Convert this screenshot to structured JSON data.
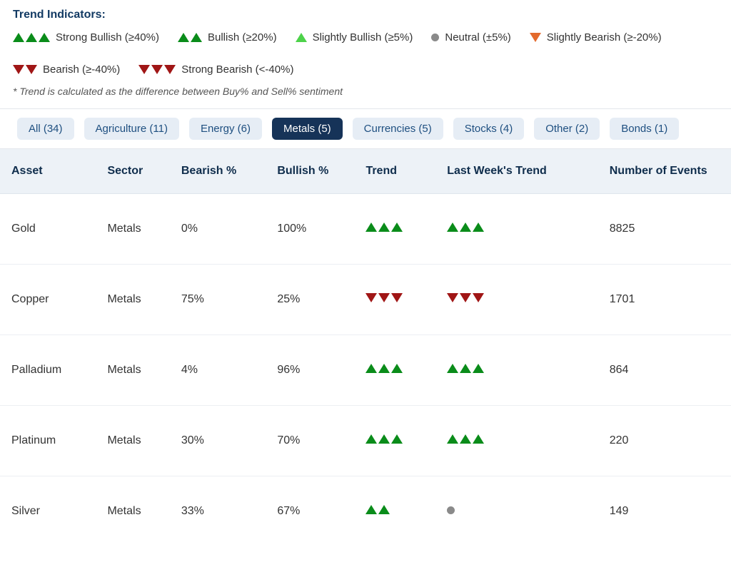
{
  "legend": {
    "title": "Trend Indicators:",
    "items": [
      {
        "icon": "up3-green",
        "label": "Strong Bullish (≥40%)"
      },
      {
        "icon": "up2-green",
        "label": "Bullish (≥20%)"
      },
      {
        "icon": "up1-lgreen",
        "label": "Slightly Bullish (≥5%)"
      },
      {
        "icon": "dot",
        "label": "Neutral (±5%)"
      },
      {
        "icon": "down1-orange",
        "label": "Slightly Bearish (≥-20%)"
      },
      {
        "icon": "down2-red",
        "label": "Bearish (≥-40%)"
      },
      {
        "icon": "down3-red",
        "label": "Strong Bearish (<-40%)"
      }
    ],
    "footnote": "* Trend is calculated as the difference between Buy% and Sell% sentiment"
  },
  "tabs": [
    {
      "label": "All (34)",
      "active": false
    },
    {
      "label": "Agriculture (11)",
      "active": false
    },
    {
      "label": "Energy (6)",
      "active": false
    },
    {
      "label": "Metals (5)",
      "active": true
    },
    {
      "label": "Currencies (5)",
      "active": false
    },
    {
      "label": "Stocks (4)",
      "active": false
    },
    {
      "label": "Other (2)",
      "active": false
    },
    {
      "label": "Bonds (1)",
      "active": false
    }
  ],
  "table": {
    "headers": {
      "asset": "Asset",
      "sector": "Sector",
      "bearish": "Bearish %",
      "bullish": "Bullish %",
      "trend": "Trend",
      "last": "Last Week's Trend",
      "events": "Number of Events"
    },
    "rows": [
      {
        "asset": "Gold",
        "sector": "Metals",
        "bearish": "0%",
        "bullish": "100%",
        "trend": "up3-green",
        "last": "up3-green",
        "events": "8825"
      },
      {
        "asset": "Copper",
        "sector": "Metals",
        "bearish": "75%",
        "bullish": "25%",
        "trend": "down3-red",
        "last": "down3-red",
        "events": "1701"
      },
      {
        "asset": "Palladium",
        "sector": "Metals",
        "bearish": "4%",
        "bullish": "96%",
        "trend": "up3-green",
        "last": "up3-green",
        "events": "864"
      },
      {
        "asset": "Platinum",
        "sector": "Metals",
        "bearish": "30%",
        "bullish": "70%",
        "trend": "up3-green",
        "last": "up3-green",
        "events": "220"
      },
      {
        "asset": "Silver",
        "sector": "Metals",
        "bearish": "33%",
        "bullish": "67%",
        "trend": "up2-green",
        "last": "dot",
        "events": "149"
      }
    ]
  }
}
